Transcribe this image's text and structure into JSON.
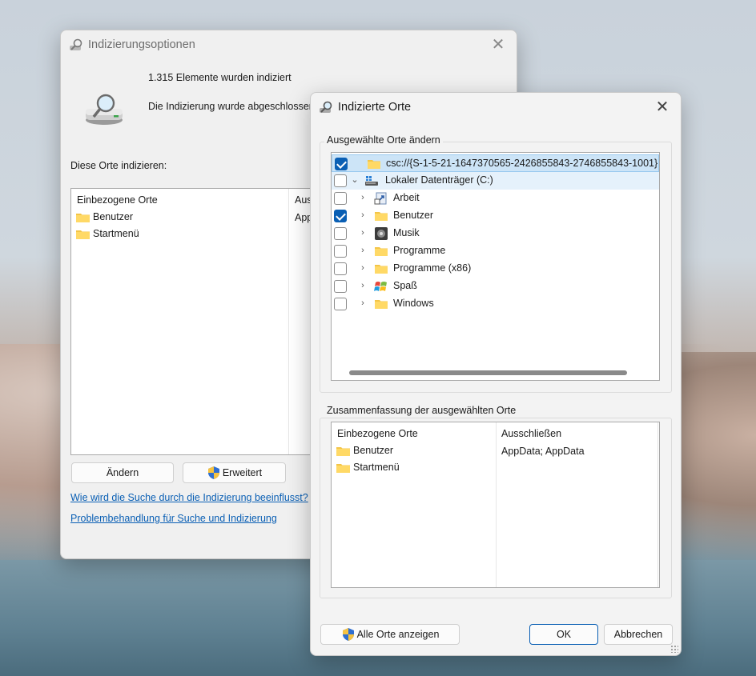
{
  "colors": {
    "accent": "#0a5fb4",
    "link": "#0a5fb4",
    "selection": "#cce4f7"
  },
  "options_window": {
    "title": "Indizierungsoptionen",
    "indexed_count": "1.315 Elemente wurden indiziert",
    "status": "Die Indizierung wurde abgeschlossen.",
    "section_label": "Diese Orte indizieren:",
    "columns": [
      "Einbezogene Orte",
      "Ausschließen"
    ],
    "column2_clip": "Aus",
    "rows": [
      {
        "name": "Benutzer",
        "exclude_clip": "App"
      },
      {
        "name": "Startmenü",
        "exclude_clip": ""
      }
    ],
    "buttons": {
      "change": "Ändern",
      "advanced": "Erweitert"
    },
    "links": {
      "how": "Wie wird die Suche durch die Indizierung beeinflusst?",
      "troubleshoot": "Problembehandlung für Suche und Indizierung"
    }
  },
  "locations_window": {
    "title": "Indizierte Orte",
    "group1": "Ausgewählte Orte ändern",
    "tree": [
      {
        "label": "csc://{S-1-5-21-1647370565-2426855843-2746855843-1001}",
        "checked": true,
        "level": 0,
        "icon": "folder-icon"
      },
      {
        "label": "Lokaler Datenträger (C:)",
        "checked": false,
        "level": 0,
        "icon": "drive-icon",
        "expanded": true
      },
      {
        "label": "Arbeit",
        "checked": false,
        "level": 1,
        "icon": "shortcut-icon"
      },
      {
        "label": "Benutzer",
        "checked": true,
        "level": 1,
        "icon": "folder-icon"
      },
      {
        "label": "Musik",
        "checked": false,
        "level": 1,
        "icon": "music-icon"
      },
      {
        "label": "Programme",
        "checked": false,
        "level": 1,
        "icon": "folder-icon"
      },
      {
        "label": "Programme (x86)",
        "checked": false,
        "level": 1,
        "icon": "folder-icon"
      },
      {
        "label": "Spaß",
        "checked": false,
        "level": 1,
        "icon": "windows-logo-icon"
      },
      {
        "label": "Windows",
        "checked": false,
        "level": 1,
        "icon": "folder-icon"
      }
    ],
    "group2": "Zusammenfassung der ausgewählten Orte",
    "summary_columns": [
      "Einbezogene Orte",
      "Ausschließen"
    ],
    "summary_rows": [
      {
        "name": "Benutzer",
        "exclude": "AppData; AppData"
      },
      {
        "name": "Startmenü",
        "exclude": ""
      }
    ],
    "buttons": {
      "show_all": "Alle Orte anzeigen",
      "ok": "OK",
      "cancel": "Abbrechen"
    }
  }
}
